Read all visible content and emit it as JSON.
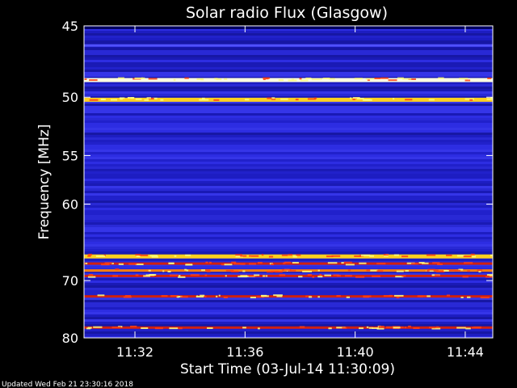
{
  "chart_data": {
    "type": "heatmap",
    "title": "Solar radio Flux (Glasgow)",
    "xlabel": "Start Time (03-Jul-14 11:30:09)",
    "ylabel": "Frequency [MHz]",
    "x_range": [
      "11:30:09",
      "11:45:00"
    ],
    "y_range": [
      45,
      80
    ],
    "y_scale": "reciprocal",
    "x_ticks": [
      "11:32",
      "11:36",
      "11:40",
      "11:44"
    ],
    "y_ticks": [
      45,
      50,
      55,
      60,
      70,
      80
    ],
    "colormap": "black-blue-red-yellow-white",
    "background_color": "#2020d0",
    "intense_bands": [
      {
        "freq_mhz": 48.7,
        "level": "white"
      },
      {
        "freq_mhz": 50.2,
        "level": "yellow"
      },
      {
        "freq_mhz": 66.5,
        "level": "yellow"
      },
      {
        "freq_mhz": 67.5,
        "level": "red"
      },
      {
        "freq_mhz": 68.5,
        "level": "orange"
      },
      {
        "freq_mhz": 69.3,
        "level": "red"
      },
      {
        "freq_mhz": 72.5,
        "level": "red"
      },
      {
        "freq_mhz": 78.0,
        "level": "red"
      }
    ],
    "footer": "Updated Wed Feb 21 23:30:16 2018"
  }
}
